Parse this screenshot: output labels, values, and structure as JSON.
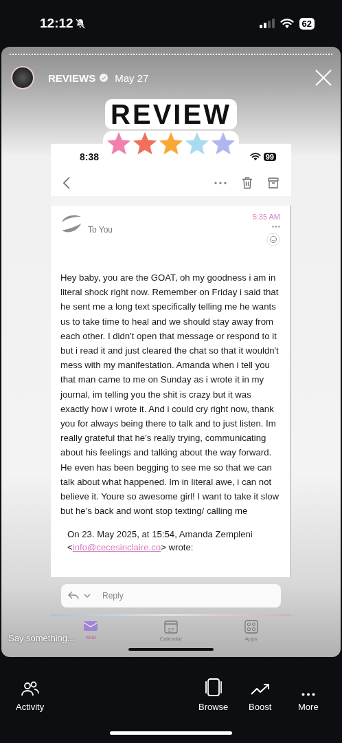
{
  "status_bar": {
    "time": "12:12",
    "battery": "62"
  },
  "story": {
    "progress": {
      "level": 1
    },
    "account": "REVIEWS",
    "date": "May 27",
    "sticker": {
      "title": "REVIEW"
    },
    "screenshot": {
      "status_bar": {
        "time": "8:38",
        "battery": "99"
      },
      "email": {
        "recipient": "To You",
        "time": "5:35 AM",
        "body": "Hey baby, you are the GOAT, oh my goodness i am in literal shock right now. Remember on Friday i said that he sent me a long text specifically telling me he wants us to take time to heal and we should stay away from each other. I didn't open that message or respond to it but i read it and just cleared the chat so that it wouldn't mess with my manifestation. Amanda when i tell you that man came to me on Sunday as i wrote it in my journal, im telling you the shit is crazy but it was exactly how i wrote it. And i could cry right now, thank you for always being there to talk and to just listen. Im really grateful that he's really trying, communicating about his feelings and talking about the way forward. He even has been begging to see me so that we can talk about what happened. Im in literal awe, i can not believe it. Youre so awesome girl!  I want to take it slow but he's back and wont stop texting/ calling me",
        "quote_prefix": "On 23. May 2025, at 15:54, Amanda Zempleni <",
        "quote_link": "info@cecesinclaire.co",
        "quote_suffix": "> wrote:"
      },
      "reply": {
        "placeholder": "Reply"
      },
      "tabs": [
        {
          "label": "Mail",
          "selected": true
        },
        {
          "label": "Calendar",
          "badge": "27",
          "selected": false
        },
        {
          "label": "Apps",
          "selected": false
        }
      ]
    },
    "message_field": {
      "placeholder": "Say something..."
    }
  },
  "bottom_nav": [
    {
      "label": "Activity"
    },
    {
      "label": "Browse"
    },
    {
      "label": "Boost"
    },
    {
      "label": "More"
    }
  ]
}
